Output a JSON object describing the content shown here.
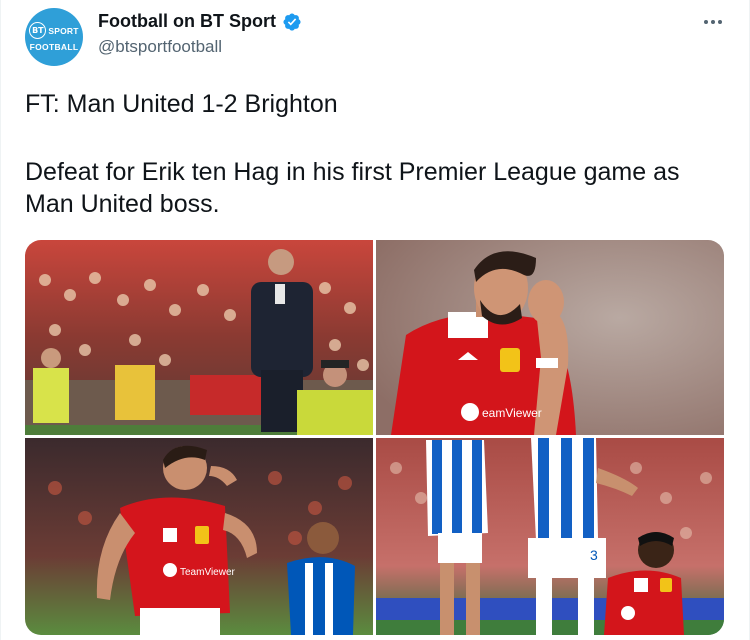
{
  "account": {
    "display_name": "Football on BT Sport",
    "handle": "@btsportfootball",
    "avatar_text_top": "SPORT",
    "avatar_badge": "BT",
    "avatar_text_bottom": "FOOTBALL",
    "verified": true
  },
  "tweet": {
    "line1": "FT: Man United 1-2 Brighton",
    "line2": "Defeat for Erik ten Hag in his first Premier League game as Man United boss."
  },
  "media": {
    "photos": [
      {
        "icon": "photo-manager-touchline"
      },
      {
        "icon": "photo-player-head-in-hand"
      },
      {
        "icon": "photo-player-rubbing-head"
      },
      {
        "icon": "photo-players-on-pitch"
      }
    ],
    "sponsor_text": "TeamViewer",
    "kit_number": "3"
  },
  "colors": {
    "accent": "#1d9bf0",
    "avatar_bg": "#2f9fd8",
    "united_red": "#d7191c",
    "brighton_blue": "#0057b8"
  }
}
